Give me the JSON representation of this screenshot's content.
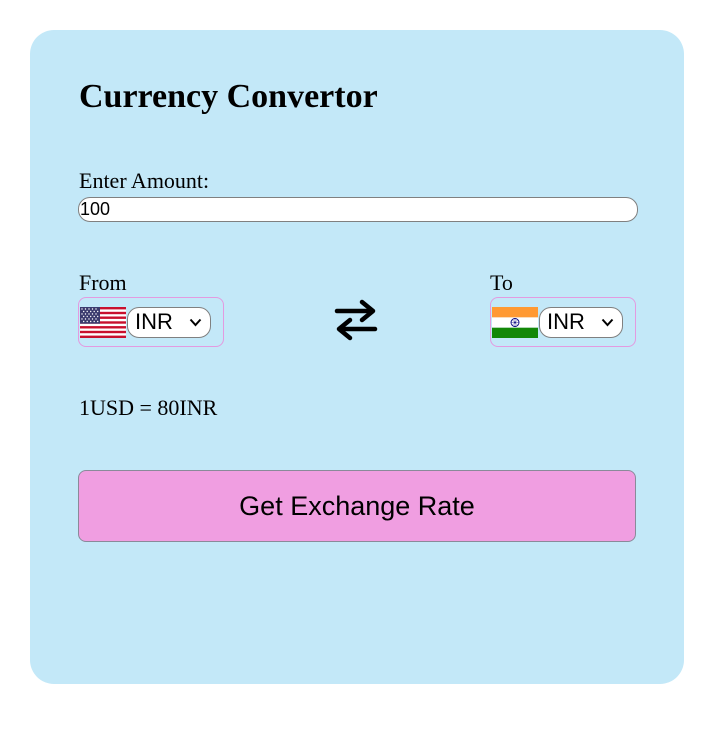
{
  "title": "Currency Convertor",
  "amount": {
    "label": "Enter Amount:",
    "value": "100"
  },
  "from": {
    "label": "From",
    "flag": "us-flag",
    "selected": "INR"
  },
  "to": {
    "label": "To",
    "flag": "india-flag",
    "selected": "INR"
  },
  "swap_icon": "swap-arrows-icon",
  "rate_text": "1USD = 80INR",
  "button_label": "Get Exchange Rate",
  "colors": {
    "card_bg": "#c3e8f8",
    "button_bg": "#f09ee1",
    "select_border": "#e39ae0"
  }
}
